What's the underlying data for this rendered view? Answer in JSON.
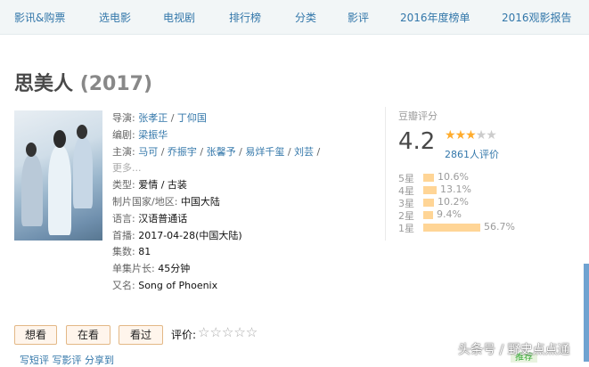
{
  "nav": {
    "items": [
      "影讯&购票",
      "选电影",
      "电视剧",
      "排行榜",
      "分类",
      "影评",
      "2016年度榜单",
      "2016观影报告"
    ]
  },
  "movie": {
    "title": "思美人",
    "year": "(2017)"
  },
  "info": {
    "director_label": "导演:",
    "directors": [
      "张孝正",
      "丁仰国"
    ],
    "writer_label": "编剧:",
    "writers": [
      "梁振华"
    ],
    "cast_label": "主演:",
    "cast": [
      "马可",
      "乔振宇",
      "张馨予",
      "易烊千玺",
      "刘芸"
    ],
    "more": "更多...",
    "genre_label": "类型:",
    "genres": "爱情 / 古装",
    "country_label": "制片国家/地区:",
    "country": "中国大陆",
    "language_label": "语言:",
    "language": "汉语普通话",
    "premiere_label": "首播:",
    "premiere": "2017-04-28(中国大陆)",
    "episodes_label": "集数:",
    "episodes": "81",
    "runtime_label": "单集片长:",
    "runtime": "45分钟",
    "aka_label": "又名:",
    "aka": "Song of Phoenix"
  },
  "rating": {
    "header": "豆瓣评分",
    "score": "4.2",
    "stars_value": 2.5,
    "count": "2861人评价",
    "distribution": [
      {
        "label": "5星",
        "pct": "10.6%",
        "value": 10.6
      },
      {
        "label": "4星",
        "pct": "13.1%",
        "value": 13.1
      },
      {
        "label": "3星",
        "pct": "10.2%",
        "value": 10.2
      },
      {
        "label": "2星",
        "pct": "9.4%",
        "value": 9.4
      },
      {
        "label": "1星",
        "pct": "56.7%",
        "value": 56.7
      }
    ]
  },
  "actions": {
    "want": "想看",
    "watching": "在看",
    "watched": "看过",
    "rate_label": "评价:",
    "rate_stars": "☆☆☆☆☆"
  },
  "bottom": {
    "links": "写短评  写影评  分享到"
  },
  "watermark": "头条号 / 野史点点通",
  "tag": "推荐",
  "colors": {
    "link": "#3377aa",
    "star": "#ffac2d",
    "bar": "#ffd596"
  }
}
